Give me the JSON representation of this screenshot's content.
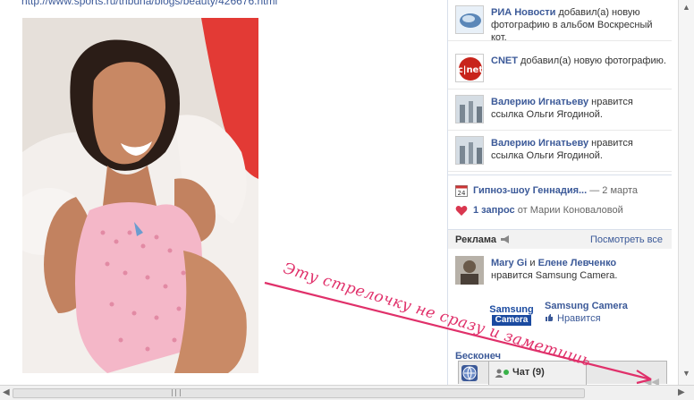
{
  "page": {
    "url_text": "http://www.sports.ru/tribuna/blogs/beauty/426676.html"
  },
  "ticker": [
    {
      "actor": "РИА Новости",
      "text": " добавил(а) новую фотографию в альбом Воскресный кот.",
      "icon": "ria-logo-icon"
    },
    {
      "actor": "CNET",
      "text": " добавил(а) новую фотографию.",
      "icon": "cnet-logo-icon"
    },
    {
      "actor": "Валерию Игнатьеву",
      "text": " нравится ссылка Ольги Ягодиной.",
      "icon": "user-photo-icon"
    },
    {
      "actor": "Валерию Игнатьеву",
      "text": " нравится ссылка Ольги Ягодиной.",
      "icon": "user-photo-icon"
    }
  ],
  "events": {
    "event_title": "Гипноз-шоу Геннадия...",
    "event_date": "— 2 марта",
    "request_title": "1 запрос",
    "request_from": " от Марии Коноваловой"
  },
  "ads": {
    "header": "Реклама",
    "see_all": "Посмотреть все",
    "ad1_names": "Mary Gi",
    "ad1_and": " и ",
    "ad1_name2": "Елене Левченко",
    "ad1_text": "нравится Samsung Camera.",
    "ad2_logo_line1": "Samsung",
    "ad2_logo_line2": "Camera",
    "ad2_title": "Samsung Camera",
    "ad2_like": "Нравится"
  },
  "partial_text": "Бесконеч",
  "chat": {
    "label": "Чат",
    "count": "(9)"
  },
  "annotation": {
    "text": "Эту стрелочку не сразу и заметишь",
    "color": "#e0306a"
  },
  "colors": {
    "link": "#3b5998",
    "accent_pink": "#e0306a",
    "online": "#3ab24a"
  }
}
